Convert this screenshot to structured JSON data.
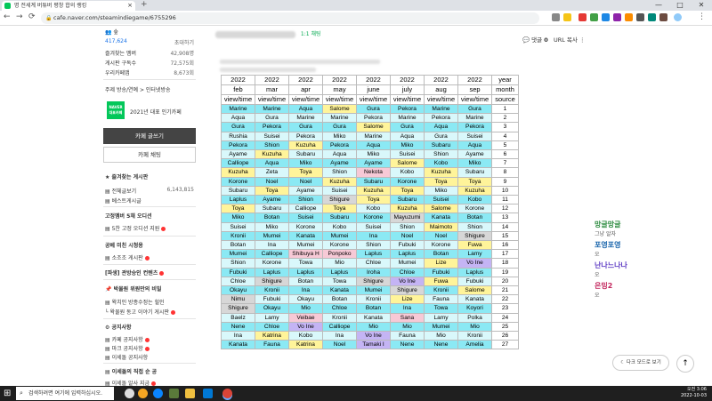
{
  "browser": {
    "tab_title": "명 전세계 버튜버 평창 합의 랭킹",
    "tab_close": "×",
    "new_tab": "+",
    "url": "cafe.naver.com/steamindiegame/6755296",
    "win": {
      "min": "—",
      "max": "□",
      "close": "✕"
    }
  },
  "sidebar": {
    "members_label": "숲",
    "members_count": "417,624",
    "invite": "초대하기",
    "stats": [
      {
        "label": "즐겨찾는 멤버",
        "value": "42,908명"
      },
      {
        "label": "게시판 구독수",
        "value": "72,575회"
      },
      {
        "label": "우리카페앱",
        "value": "8,673회"
      }
    ],
    "topic": "주제 방송/연예 > 인터넷방송",
    "badge_text": "NAVER 대표카페",
    "award": "2021년 대표 인기카페",
    "write_btn": "카페 글쓰기",
    "chat_btn": "카페 채팅",
    "fav_board_title": "즐겨찾는 게시판",
    "all_posts": "전체글보기",
    "all_posts_count": "6,143,815",
    "best_posts": "베스트게시글",
    "fixed_title": "고정멤버 5채 오디션",
    "fixed_item": "5찬 고정 오디션 지원",
    "section2": "공베 미친 시청용",
    "section2_item": "소조조 게시판",
    "section3": "[파생] 관방승인 컨텐츠",
    "section4": "박물원 위원만의 비밀",
    "section4_items": [
      "왁치인 방종수정는 힐인",
      "왁물원 동고 이야기 게시판"
    ],
    "notice_title": "공지사항",
    "notice_items": [
      "카페 공지사항",
      "마크 공지사항",
      "이세돌 공지사항"
    ],
    "last_section": "이세돌의 직접 순 공",
    "last_item": "이세돌 알사 지금"
  },
  "post": {
    "chat_label": "1:1 채팅",
    "comments_label": "댓글",
    "comments_count": "0",
    "url_copy": "URL 복사"
  },
  "table": {
    "year_row": [
      "2022",
      "2022",
      "2022",
      "2022",
      "2022",
      "2022",
      "2022",
      "2022",
      "year"
    ],
    "month_row": [
      "feb",
      "mar",
      "apr",
      "may",
      "june",
      "july",
      "aug",
      "sep",
      "month"
    ],
    "vt_row": [
      "view/time",
      "view/time",
      "view/time",
      "view/time",
      "view/time",
      "view/time",
      "view/time",
      "view/time",
      "source"
    ],
    "rows": [
      [
        "Marine",
        "Marine",
        "Aqua",
        "Salome",
        "Gura",
        "Pekora",
        "Marine",
        "Gura",
        "1"
      ],
      [
        "Aqua",
        "Gura",
        "Marine",
        "Marine",
        "Pekora",
        "Marine",
        "Pekora",
        "Marine",
        "2"
      ],
      [
        "Gura",
        "Pekora",
        "Gura",
        "Gura",
        "Salome",
        "Gura",
        "Aqua",
        "Pekora",
        "3"
      ],
      [
        "Rushia",
        "Suisei",
        "Pekora",
        "Miko",
        "Marine",
        "Aqua",
        "Gura",
        "Suisei",
        "4"
      ],
      [
        "Pekora",
        "Shion",
        "Kuzuha",
        "Pekora",
        "Aqua",
        "Miko",
        "Subaru",
        "Aqua",
        "5"
      ],
      [
        "Ayame",
        "Kuzuha",
        "Subaru",
        "Aqua",
        "Miko",
        "Suisei",
        "Shion",
        "Ayame",
        "6"
      ],
      [
        "Calliope",
        "Aqua",
        "Miko",
        "Ayame",
        "Ayame",
        "Salome",
        "Kobo",
        "Miko",
        "7"
      ],
      [
        "Kuzuha",
        "Zeta",
        "Toya",
        "Shion",
        "Nekota",
        "Kobo",
        "Kuzuha",
        "Subaru",
        "8"
      ],
      [
        "Korone",
        "Noel",
        "Noel",
        "Kuzuha",
        "Subaru",
        "Korone",
        "Toya",
        "Toya",
        "9"
      ],
      [
        "Subaru",
        "Toya",
        "Ayame",
        "Suisei",
        "Kuzuha",
        "Toya",
        "Miko",
        "Kuzuha",
        "10"
      ],
      [
        "Laplus",
        "Ayame",
        "Shion",
        "Shigure",
        "Toya",
        "Subaru",
        "Suisei",
        "Kobo",
        "11"
      ],
      [
        "Toya",
        "Subaru",
        "Calliope",
        "Toya",
        "Kobo",
        "Kuzuha",
        "Salome",
        "Korone",
        "12"
      ],
      [
        "Miko",
        "Botan",
        "Suisei",
        "Subaru",
        "Korone",
        "Mayuzumi",
        "Kanata",
        "Botan",
        "13"
      ],
      [
        "Suisei",
        "Miko",
        "Korone",
        "Kobo",
        "Suisei",
        "Shion",
        "Maimoto",
        "Shion",
        "14"
      ],
      [
        "Kronii",
        "Mumei",
        "Kanata",
        "Mumei",
        "Ina",
        "Noel",
        "Noel",
        "Shigure",
        "15"
      ],
      [
        "Botan",
        "Ina",
        "Mumei",
        "Korone",
        "Shion",
        "Fubuki",
        "Korone",
        "Fuwa",
        "16"
      ],
      [
        "Mumei",
        "Calliope",
        "Shibuya H",
        "Ponpoko",
        "Laplus",
        "Laplus",
        "Botan",
        "Lamy",
        "17"
      ],
      [
        "Shion",
        "Korone",
        "Towa",
        "Mio",
        "Chloe",
        "Mumei",
        "Lize",
        "Vo Ine",
        "18"
      ],
      [
        "Fubuki",
        "Laplus",
        "Laplus",
        "Laplus",
        "Iroha",
        "Chloe",
        "Fubuki",
        "Laplus",
        "19"
      ],
      [
        "Chloe",
        "Shigure",
        "Botan",
        "Towa",
        "Shigure",
        "Vo Ine",
        "Fuwa",
        "Fubuki",
        "20"
      ],
      [
        "Okayu",
        "Kronii",
        "Ina",
        "Kanata",
        "Mumei",
        "Shigure",
        "Kronii",
        "Salome",
        "21"
      ],
      [
        "Nimu",
        "Fubuki",
        "Okayu",
        "Botan",
        "Kronii",
        "Lize",
        "Fauna",
        "Kanata",
        "22"
      ],
      [
        "Shigure",
        "Okayu",
        "Mio",
        "Chloe",
        "Botan",
        "Ina",
        "Towa",
        "Koyori",
        "23"
      ],
      [
        "Baelz",
        "Lamy",
        "Veibae",
        "Kronii",
        "Kanata",
        "Sana",
        "Lamy",
        "Polka",
        "24"
      ],
      [
        "Nene",
        "Chloe",
        "Vo Ine",
        "Calliope",
        "Mio",
        "Mio",
        "Mumei",
        "Mio",
        "25"
      ],
      [
        "Ina",
        "Katrina",
        "Kobo",
        "Ina",
        "Vo Ine",
        "Fauna",
        "Mio",
        "Kronii",
        "26"
      ],
      [
        "Kanata",
        "Fauna",
        "Katrina",
        "Noel",
        "Tamaki I",
        "Nene",
        "Nene",
        "Amelia",
        "27"
      ]
    ]
  },
  "chat_users": [
    {
      "name": "망글망글",
      "sub": "그냥 알자",
      "color": "#2b8a3e"
    },
    {
      "name": "포영포영",
      "sub": "오",
      "color": "#1864ab"
    },
    {
      "name": "난나느나나",
      "sub": "오",
      "color": "#5f3dc4"
    },
    {
      "name": "은밍2",
      "sub": "오",
      "color": "#c2255c"
    }
  ],
  "darkmode": "다크 모드로 보기",
  "top_btn": "↑",
  "taskbar": {
    "search_placeholder": "검색하려면 여기에 입력하십시오.",
    "time": "오전 3:06",
    "date": "2022-10-03"
  }
}
